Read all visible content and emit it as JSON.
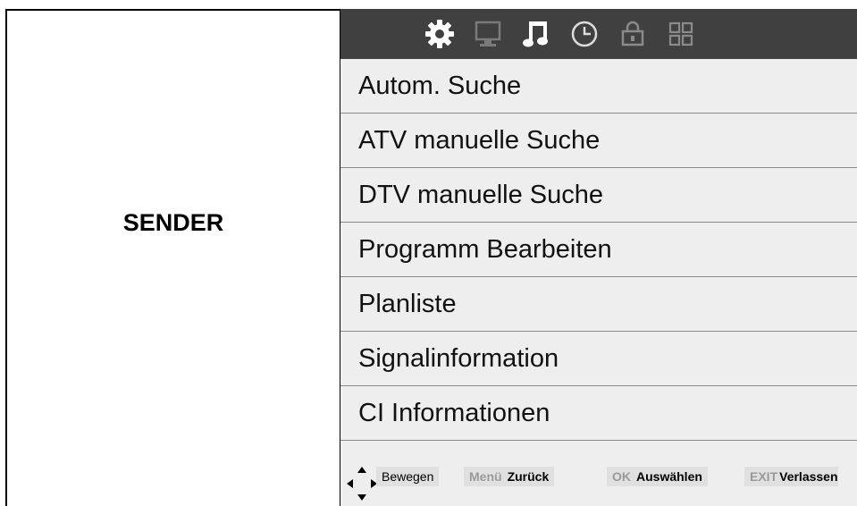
{
  "section": {
    "title": "SENDER"
  },
  "topbar": {
    "icons": [
      "gear-icon",
      "monitor-icon",
      "music-note-icon",
      "clock-icon",
      "lock-icon",
      "grid-icon"
    ]
  },
  "menu": {
    "items": [
      {
        "label": "Autom. Suche"
      },
      {
        "label": "ATV manuelle Suche"
      },
      {
        "label": "DTV manuelle Suche"
      },
      {
        "label": "Programm Bearbeiten"
      },
      {
        "label": "Planliste"
      },
      {
        "label": "Signalinformation"
      },
      {
        "label": "CI Informationen"
      }
    ]
  },
  "hints": {
    "move_label": "Bewegen",
    "menu_key": "Menü",
    "menu_action": "Zurück",
    "ok_key": "OK",
    "ok_action": "Auswählen",
    "exit_key": "EXIT",
    "exit_action": "Verlassen"
  },
  "colors": {
    "topbar": "#404040",
    "menu_bg": "#eeeeee",
    "divider": "#8a8a8a",
    "hint_key": "#9a9a9a"
  }
}
